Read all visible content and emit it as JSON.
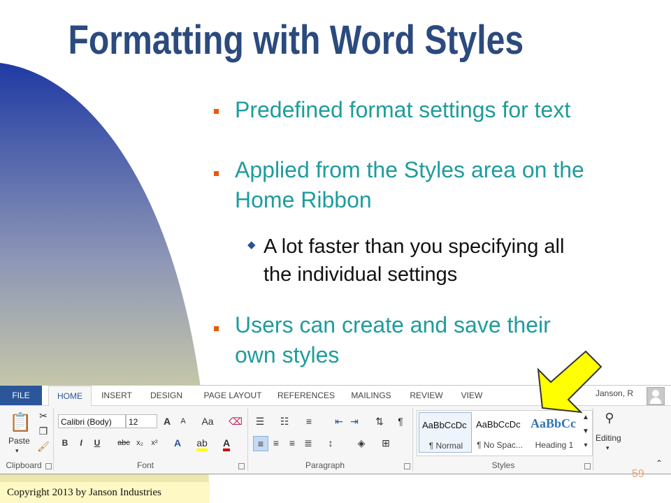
{
  "slide": {
    "title": "Formatting with Word Styles",
    "bullets": [
      {
        "lines": [
          "Predefined format settings for text"
        ]
      },
      {
        "lines": [
          "Applied from the Styles area on the",
          "Home Ribbon"
        ]
      },
      {
        "lines": [
          "Users can create and save their",
          "own styles"
        ]
      }
    ],
    "sub_bullet": {
      "lines": [
        "A lot faster than you specifying all",
        "the individual settings"
      ]
    },
    "copyright": "Copyright 2013 by Janson Industries",
    "slide_number": "59",
    "colors": {
      "title": "#2b4a7e",
      "bullet_text": "#1f9c9c",
      "bullet_mark": "#e8590c",
      "arrow": "#ffff00"
    }
  },
  "ribbon": {
    "tabs": [
      "FILE",
      "HOME",
      "INSERT",
      "DESIGN",
      "PAGE LAYOUT",
      "REFERENCES",
      "MAILINGS",
      "REVIEW",
      "VIEW"
    ],
    "active_tab": "HOME",
    "user": "Janson, R",
    "groups": {
      "clipboard": "Clipboard",
      "font": "Font",
      "paragraph": "Paragraph",
      "styles": "Styles"
    },
    "paste_label": "Paste",
    "font_name": "Calibri (Body)",
    "font_size": "12",
    "editing_label": "Editing",
    "styles": [
      {
        "sample": "AaBbCcDc",
        "name": "¶ Normal"
      },
      {
        "sample": "AaBbCcDc",
        "name": "¶ No Spac..."
      },
      {
        "sample": "AaBbCc",
        "name": "Heading 1"
      }
    ],
    "font_buttons": {
      "bold": "B",
      "italic": "I",
      "underline": "U",
      "strike": "abc",
      "subscript": "x₂",
      "superscript": "x²",
      "grow": "A",
      "shrink": "A",
      "case": "Aa"
    }
  }
}
